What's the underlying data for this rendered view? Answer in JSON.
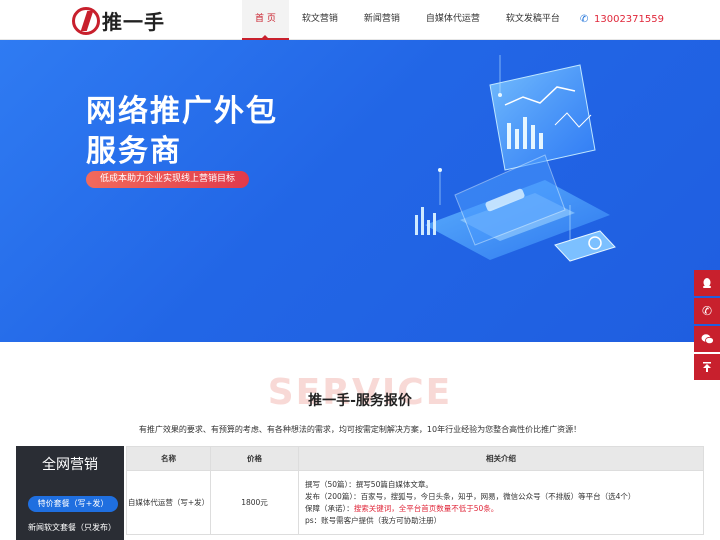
{
  "brand": {
    "name": "推一手"
  },
  "nav": {
    "items": [
      "首 页",
      "软文营销",
      "新闻营销",
      "自媒体代运营",
      "软文发稿平台"
    ],
    "active_index": 0
  },
  "phone": {
    "number": "13002371559"
  },
  "banner": {
    "title_line1": "网络推广外包",
    "title_line2": "服务商",
    "subtitle": "低成本助力企业实现线上营销目标"
  },
  "service": {
    "bg_word": "SERVICE",
    "title": "推一手-服务报价",
    "desc": "有推广效果的要求、有预算的考虑、有各种想法的需求，均可按需定制解决方案，10年行业经验为您整合高性价比推广资源！"
  },
  "left_panel": {
    "title": "全网营销",
    "items": [
      "特价套餐（写+发）",
      "新闻软文套餐（只发布）"
    ]
  },
  "table": {
    "headers": [
      "名称",
      "价格",
      "相关介绍"
    ],
    "rows": [
      {
        "name": "自媒体代运营（写+发）",
        "price": "1800元",
        "line1": "撰写（50篇）：撰写50篇自媒体文章。",
        "line2": "发布（200篇）：百家号，搜狐号，今日头条，知乎，网易，微信公众号（不排版）等平台（选4个）",
        "line3_label": "保障（承诺）：",
        "line3_red": "搜索关键词，全平台首页数量不低于50条。",
        "line4": "ps：账号需客户提供（我方可协助注册）"
      }
    ]
  },
  "floating_bar": {
    "icons": [
      "qq-icon",
      "phone-icon",
      "wechat-icon",
      "back-to-top-icon"
    ]
  },
  "colors": {
    "brand_red": "#c8202d",
    "banner_blue": "#2266e6",
    "accent_blue": "#1f6fe0"
  }
}
